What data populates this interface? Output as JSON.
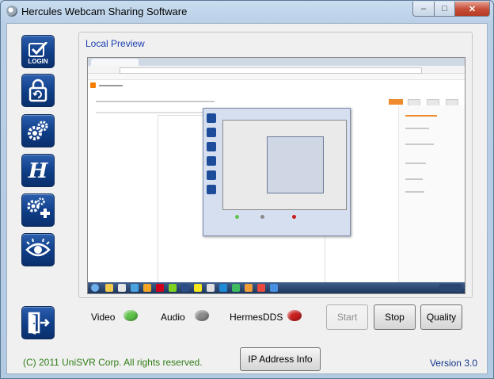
{
  "window": {
    "title": "Hercules Webcam Sharing Software",
    "controls": {
      "minimize": "–",
      "maximize": "□",
      "close": "✕"
    }
  },
  "sidebar": {
    "items": [
      {
        "id": "login",
        "label": "LOGIN",
        "icon": "login-check-icon"
      },
      {
        "id": "refresh",
        "label": "",
        "icon": "lock-refresh-icon"
      },
      {
        "id": "settings",
        "label": "",
        "icon": "gears-icon"
      },
      {
        "id": "hercules",
        "label": "",
        "icon": "hercules-h-icon"
      },
      {
        "id": "add-settings",
        "label": "",
        "icon": "gears-plus-icon"
      },
      {
        "id": "view",
        "label": "",
        "icon": "eye-icon"
      },
      {
        "id": "exit",
        "label": "",
        "icon": "exit-door-icon"
      }
    ]
  },
  "preview": {
    "group_label": "Local Preview"
  },
  "status": {
    "video": {
      "label": "Video",
      "color": "#5fc24a"
    },
    "audio": {
      "label": "Audio",
      "color": "#8a8a8a"
    },
    "hermes": {
      "label": "HermesDDS",
      "color": "#c81e1e"
    }
  },
  "buttons": {
    "start": "Start",
    "stop": "Stop",
    "quality": "Quality",
    "ip_info": "IP Address Info"
  },
  "footer": {
    "copyright": "(C) 2011 UniSVR Corp. All rights reserved.",
    "version": "Version 3.0"
  },
  "colors": {
    "label_blue": "#1a3fb0",
    "copyright_green": "#2f7d16",
    "version_blue": "#12368c",
    "sidebar_blue": "#0f3d86"
  }
}
